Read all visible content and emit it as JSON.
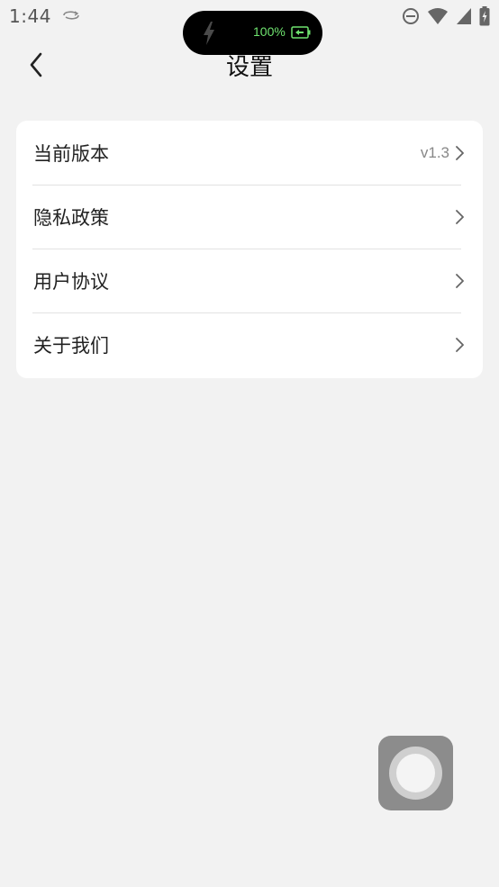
{
  "status_bar": {
    "time": "1:44",
    "icons": [
      "sync-icon",
      "do-not-disturb-icon",
      "wifi-icon",
      "cell-signal-icon",
      "battery-icon"
    ]
  },
  "charging_indicator": {
    "percent_text": "100%",
    "icons": [
      "lightning-bolt-icon",
      "battery-charging-icon"
    ],
    "text_color": "#6fe36f"
  },
  "header": {
    "title": "设置",
    "back_icon": "back-chevron-icon"
  },
  "settings": {
    "items": [
      {
        "label": "当前版本",
        "value": "v1.3"
      },
      {
        "label": "隐私政策",
        "value": ""
      },
      {
        "label": "用户协议",
        "value": ""
      },
      {
        "label": "关于我们",
        "value": ""
      }
    ],
    "chevron_icon": "chevron-right-icon"
  },
  "floating_button": {
    "icon": "assistive-touch-icon"
  },
  "colors": {
    "background": "#f2f2f2",
    "card": "#ffffff",
    "text": "#222222",
    "secondary_text": "#888888"
  }
}
